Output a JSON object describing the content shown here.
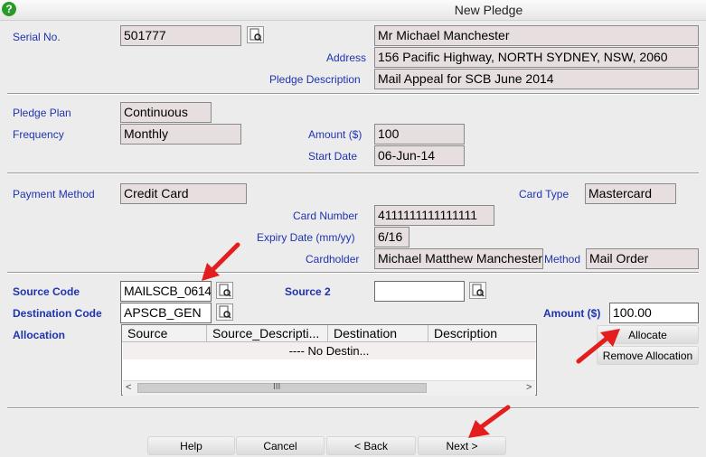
{
  "window": {
    "title": "New Pledge"
  },
  "pledge": {
    "serial_label": "Serial No.",
    "serial_value": "501777",
    "name_value": "Mr Michael Manchester",
    "address_label": "Address",
    "address_value": "156 Pacific Highway, NORTH SYDNEY, NSW, 2060",
    "description_label": "Pledge Description",
    "description_value": "Mail Appeal for SCB June 2014"
  },
  "plan": {
    "plan_label": "Pledge Plan",
    "plan_value": "Continuous",
    "frequency_label": "Frequency",
    "frequency_value": "Monthly",
    "amount_label": "Amount ($)",
    "amount_value": "100",
    "start_label": "Start Date",
    "start_value": "06-Jun-14"
  },
  "payment": {
    "method_label": "Payment Method",
    "method_value": "Credit Card",
    "card_type_label": "Card Type",
    "card_type_value": "Mastercard",
    "card_number_label": "Card Number",
    "card_number_value": "4111111111111111",
    "expiry_label": "Expiry Date (mm/yy)",
    "expiry_value": "6/16",
    "cardholder_label": "Cardholder",
    "cardholder_value": "Michael Matthew Manchester",
    "method2_label": "Method",
    "method2_value": "Mail Order"
  },
  "source": {
    "source_code_label": "Source Code",
    "source_code_value": "MAILSCB_0614",
    "source2_label": "Source 2",
    "source2_value": "",
    "destination_label": "Destination Code",
    "destination_value": "APSCB_GEN",
    "amount_label": "Amount ($)",
    "amount_value": "100.00",
    "allocation_label": "Allocation",
    "allocate_button": "Allocate",
    "remove_button": "Remove Allocation"
  },
  "allocation_grid": {
    "columns": [
      "Source",
      "Source_Descripti...",
      "Destination",
      "Description"
    ],
    "rows": [
      "---- No Destin..."
    ],
    "scroll_left": "<",
    "scroll_right": ">",
    "scroll_thumb": "III"
  },
  "footer": {
    "help": "Help",
    "cancel": "Cancel",
    "back": "< Back",
    "next": "Next >"
  },
  "colors": {
    "label": "#1f33b0",
    "readonly_bg": "#e7dfdf",
    "arrow": "#e31e1e"
  }
}
